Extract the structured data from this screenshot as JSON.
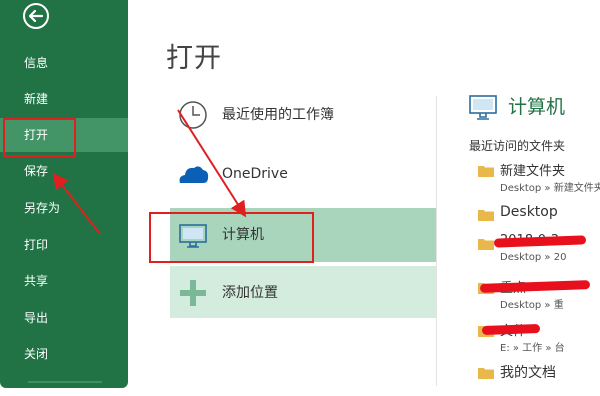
{
  "sidebar": {
    "back_icon": "back-arrow-icon",
    "items": [
      {
        "label": "信息"
      },
      {
        "label": "新建"
      },
      {
        "label": "打开"
      },
      {
        "label": "保存"
      },
      {
        "label": "另存为"
      },
      {
        "label": "打印"
      },
      {
        "label": "共享"
      },
      {
        "label": "导出"
      },
      {
        "label": "关闭"
      }
    ],
    "active_item": "打开"
  },
  "main": {
    "title": "打开",
    "places": [
      {
        "label": "最近使用的工作簿",
        "icon": "clock-icon"
      },
      {
        "label": "OneDrive",
        "icon": "cloud-icon"
      },
      {
        "label": "计算机",
        "icon": "computer-icon"
      },
      {
        "label": "添加位置",
        "icon": "plus-icon"
      }
    ],
    "selected_place": "计算机"
  },
  "right_panel": {
    "title": "计算机",
    "icon": "computer-icon",
    "recent_label": "最近访问的文件夹",
    "folders": [
      {
        "name": "新建文件夹",
        "path": "Desktop » 新建文件夹"
      },
      {
        "name": "Desktop",
        "path": ""
      },
      {
        "name": "2018-0-3",
        "path": "Desktop » 20"
      },
      {
        "name": "重点",
        "path": "Desktop » 重"
      },
      {
        "name": "文件",
        "path": "E: » 工作 » 台"
      },
      {
        "name": "我的文档",
        "path": ""
      }
    ]
  },
  "colors": {
    "sidebar_bg": "#217346",
    "active_nav_bg": "#439467",
    "selected_place_bg": "#a8d5bc",
    "hover_place_bg": "#d3ecde",
    "accent_green": "#217346",
    "annotation_red": "#e02020"
  }
}
